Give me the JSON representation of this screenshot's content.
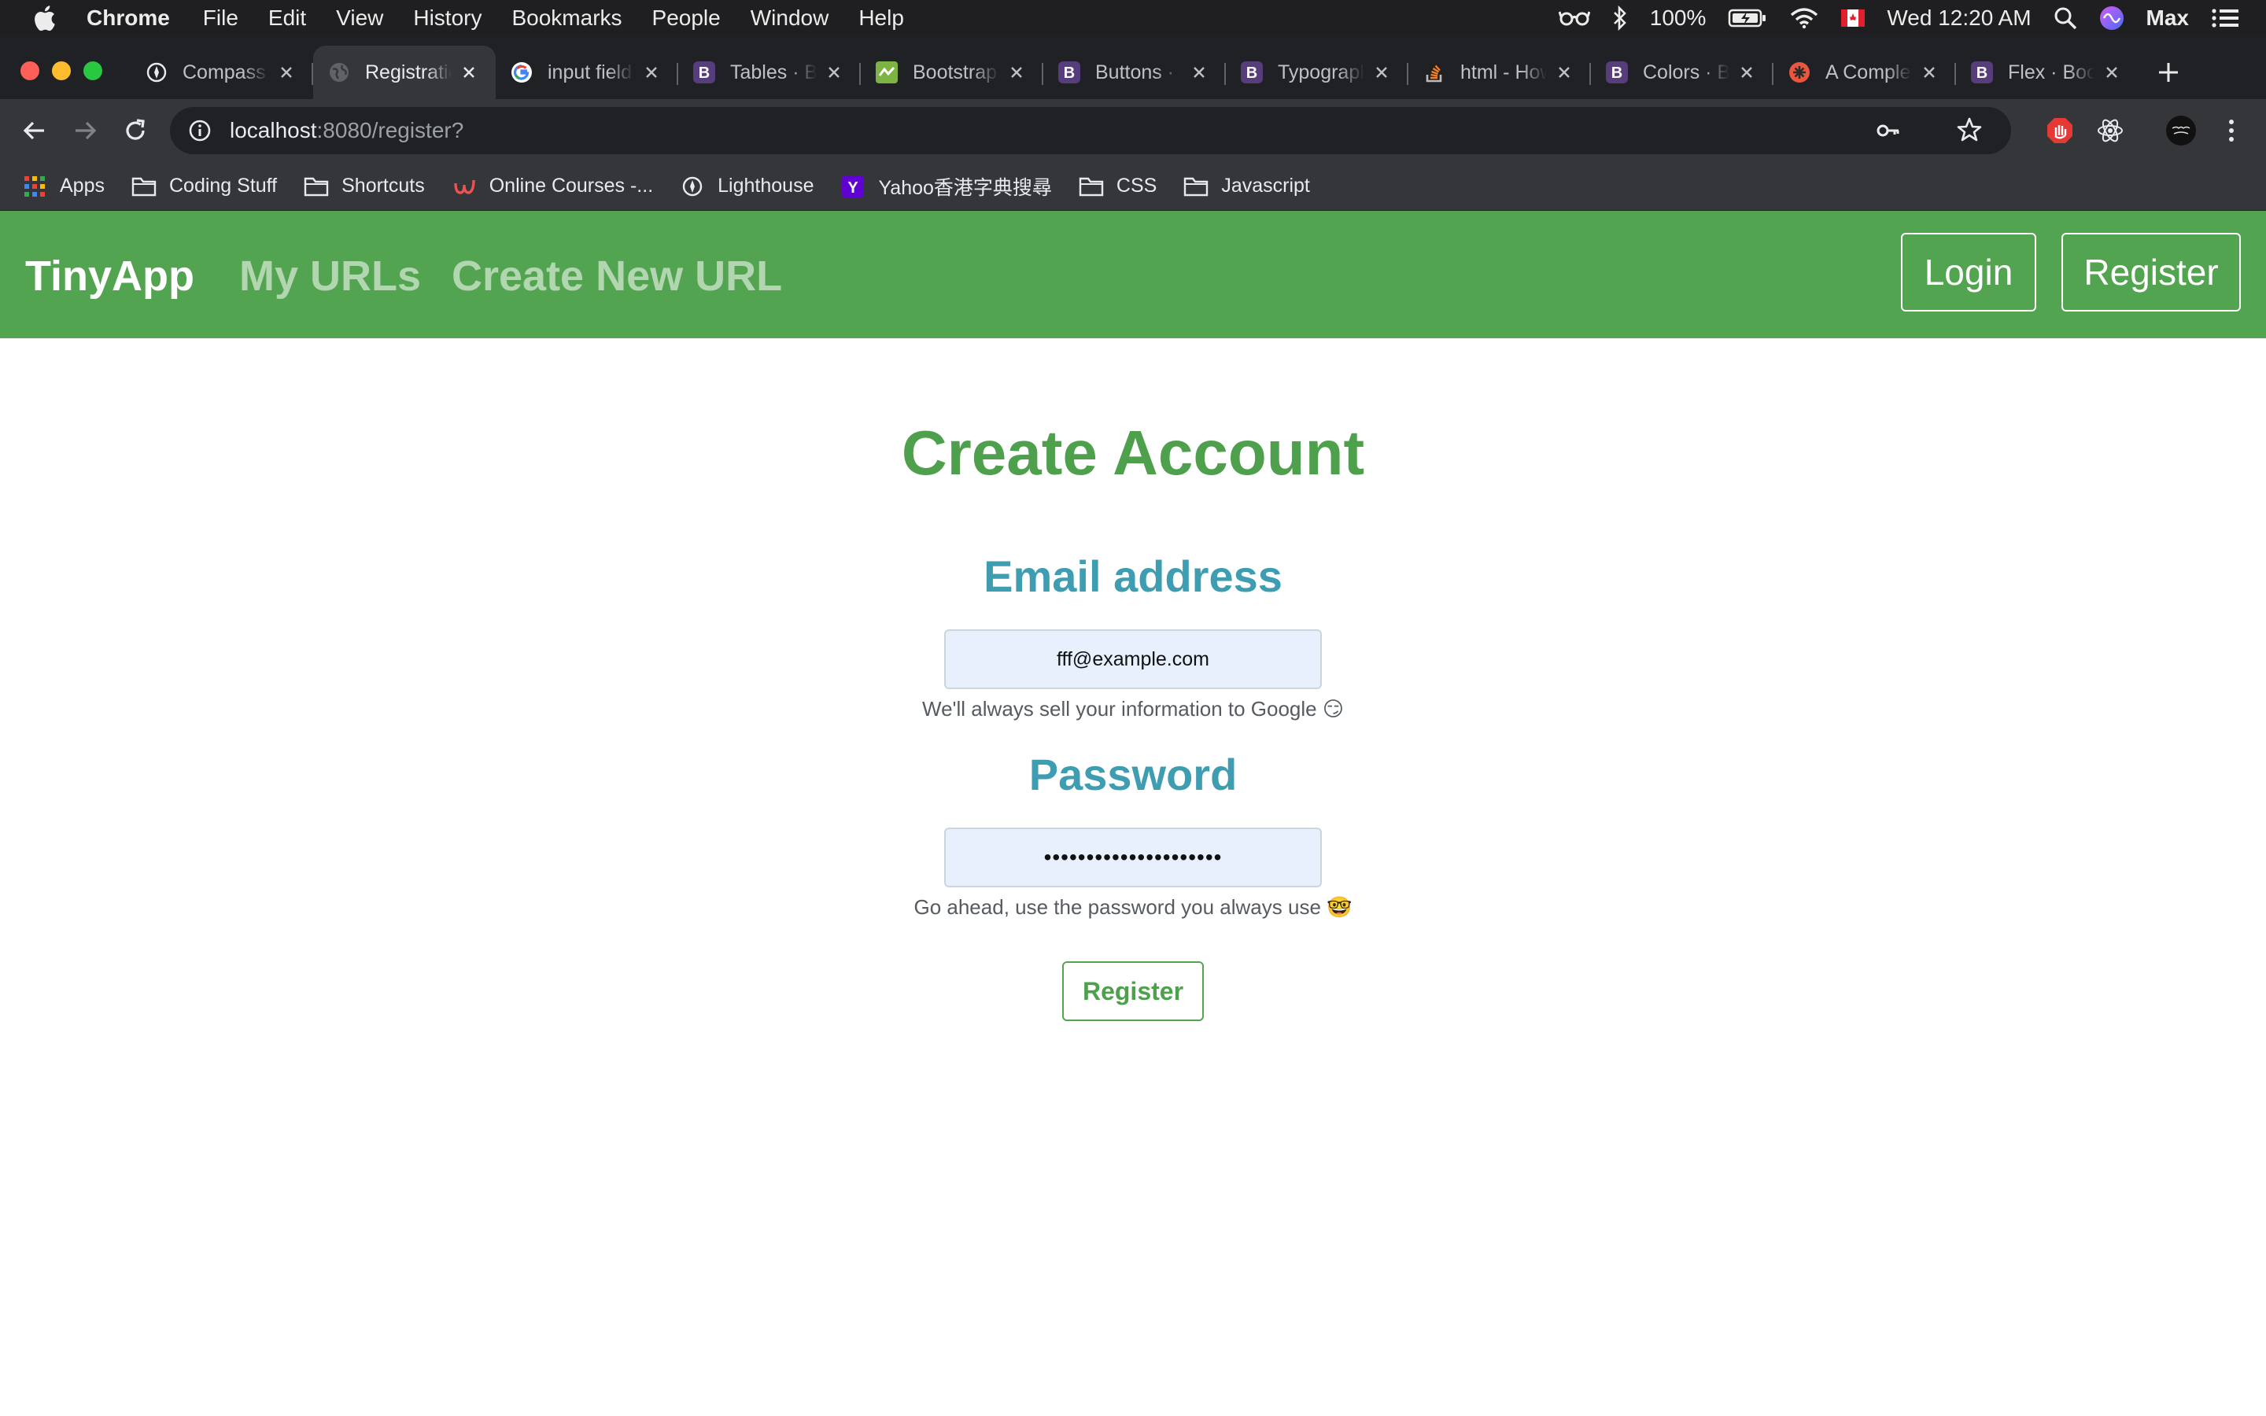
{
  "menubar": {
    "app": "Chrome",
    "items": [
      "File",
      "Edit",
      "View",
      "History",
      "Bookmarks",
      "People",
      "Window",
      "Help"
    ],
    "battery": "100%",
    "clock": "Wed 12:20 AM",
    "user": "Max"
  },
  "tabs": [
    {
      "title": "Compass",
      "icon": "compass-icon",
      "active": false
    },
    {
      "title": "Registration",
      "icon": "globe-icon",
      "active": true
    },
    {
      "title": "input field",
      "icon": "google-icon",
      "active": false
    },
    {
      "title": "Tables · Bootstrap",
      "icon": "bootstrap-icon",
      "active": false
    },
    {
      "title": "Bootstrap",
      "icon": "bootstrap-green-icon",
      "active": false
    },
    {
      "title": "Buttons · Bootstrap",
      "icon": "bootstrap-icon",
      "active": false
    },
    {
      "title": "Typography",
      "icon": "bootstrap-icon",
      "active": false
    },
    {
      "title": "html - How",
      "icon": "stackoverflow-icon",
      "active": false
    },
    {
      "title": "Colors · Bootstrap",
      "icon": "bootstrap-icon",
      "active": false
    },
    {
      "title": "A Complete",
      "icon": "csstricks-icon",
      "active": false
    },
    {
      "title": "Flex · Bootstrap",
      "icon": "bootstrap-icon",
      "active": false
    }
  ],
  "address_bar": {
    "host": "localhost",
    "rest": ":8080/register?"
  },
  "bookmarks": [
    {
      "label": "Apps",
      "icon": "apps-grid-icon"
    },
    {
      "label": "Coding Stuff",
      "icon": "folder-icon"
    },
    {
      "label": "Shortcuts",
      "icon": "folder-icon"
    },
    {
      "label": "Online Courses -...",
      "icon": "udemy-icon"
    },
    {
      "label": "Lighthouse",
      "icon": "compass-icon"
    },
    {
      "label": "Yahoo香港字典搜尋",
      "icon": "yahoo-icon"
    },
    {
      "label": "CSS",
      "icon": "folder-icon"
    },
    {
      "label": "Javascript",
      "icon": "folder-icon"
    }
  ],
  "navbar": {
    "brand": "TinyApp",
    "my_urls": "My URLs",
    "create_new": "Create New URL",
    "login": "Login",
    "register": "Register"
  },
  "form": {
    "title": "Create Account",
    "email_label": "Email address",
    "email_value": "fff@example.com",
    "email_help": "We'll always sell your information to Google 😏",
    "password_label": "Password",
    "password_value": "•••••••••••••••••••••",
    "password_help": "Go ahead, use the password you always use 🤓",
    "submit": "Register"
  },
  "colors": {
    "navbar_green": "#53a450",
    "heading_green": "#4fa04d",
    "label_teal": "#3f9db1",
    "input_fill": "#e8f0fe"
  }
}
